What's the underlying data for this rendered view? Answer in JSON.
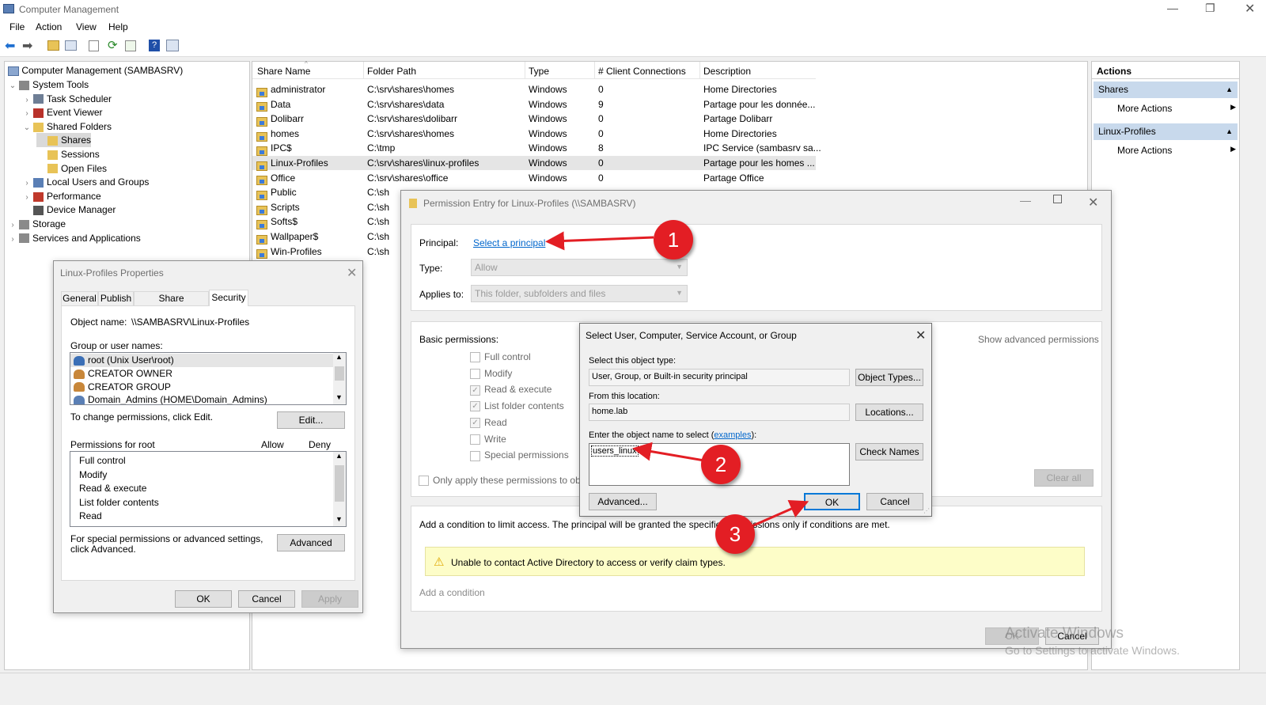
{
  "window": {
    "title": "Computer Management"
  },
  "menu": [
    "File",
    "Action",
    "View",
    "Help"
  ],
  "tree": {
    "root": "Computer Management (SAMBASRV)",
    "items": [
      {
        "label": "System Tools",
        "depth": 1,
        "exp": "v"
      },
      {
        "label": "Task Scheduler",
        "depth": 2,
        "exp": ">"
      },
      {
        "label": "Event Viewer",
        "depth": 2,
        "exp": ">"
      },
      {
        "label": "Shared Folders",
        "depth": 2,
        "exp": "v"
      },
      {
        "label": "Shares",
        "depth": 3,
        "exp": ""
      },
      {
        "label": "Sessions",
        "depth": 3,
        "exp": ""
      },
      {
        "label": "Open Files",
        "depth": 3,
        "exp": ""
      },
      {
        "label": "Local Users and Groups",
        "depth": 2,
        "exp": ">"
      },
      {
        "label": "Performance",
        "depth": 2,
        "exp": ">"
      },
      {
        "label": "Device Manager",
        "depth": 2,
        "exp": ""
      },
      {
        "label": "Storage",
        "depth": 1,
        "exp": ">"
      },
      {
        "label": "Services and Applications",
        "depth": 1,
        "exp": ">"
      }
    ]
  },
  "shares": {
    "columns": [
      "Share Name",
      "Folder Path",
      "Type",
      "# Client Connections",
      "Description"
    ],
    "rows": [
      [
        "administrator",
        "C:\\srv\\shares\\homes",
        "Windows",
        "0",
        "Home Directories"
      ],
      [
        "Data",
        "C:\\srv\\shares\\data",
        "Windows",
        "9",
        "Partage pour les donnée..."
      ],
      [
        "Dolibarr",
        "C:\\srv\\shares\\dolibarr",
        "Windows",
        "0",
        "Partage Dolibarr"
      ],
      [
        "homes",
        "C:\\srv\\shares\\homes",
        "Windows",
        "0",
        "Home Directories"
      ],
      [
        "IPC$",
        "C:\\tmp",
        "Windows",
        "8",
        "IPC Service (sambasrv sa..."
      ],
      [
        "Linux-Profiles",
        "C:\\srv\\shares\\linux-profiles",
        "Windows",
        "0",
        "Partage pour les homes ..."
      ],
      [
        "Office",
        "C:\\srv\\shares\\office",
        "Windows",
        "0",
        "Partage Office"
      ],
      [
        "Public",
        "C:\\sh",
        "",
        "",
        ""
      ],
      [
        "Scripts",
        "C:\\sh",
        "",
        "",
        ""
      ],
      [
        "Softs$",
        "C:\\sh",
        "",
        "",
        ""
      ],
      [
        "Wallpaper$",
        "C:\\sh",
        "",
        "",
        ""
      ],
      [
        "Win-Profiles",
        "C:\\sh",
        "",
        "",
        ""
      ]
    ]
  },
  "actions": {
    "header": "Actions",
    "sections": [
      {
        "title": "Shares",
        "item": "More Actions"
      },
      {
        "title": "Linux-Profiles",
        "item": "More Actions"
      }
    ]
  },
  "props": {
    "title": "Linux-Profiles Properties",
    "tabs": [
      "General",
      "Publish",
      "Share Permissions",
      "Security"
    ],
    "object_label": "Object name:",
    "object_value": "\\\\SAMBASRV\\Linux-Profiles",
    "group_label": "Group or user names:",
    "groups": [
      "root (Unix User\\root)",
      "CREATOR OWNER",
      "CREATOR GROUP",
      "Domain_Admins (HOME\\Domain_Admins)"
    ],
    "change_text": "To change permissions, click Edit.",
    "edit": "Edit...",
    "perm_for": "Permissions for root",
    "allow": "Allow",
    "deny": "Deny",
    "perms": [
      "Full control",
      "Modify",
      "Read & execute",
      "List folder contents",
      "Read"
    ],
    "special_text": "For special permissions or advanced settings, click Advanced.",
    "advanced": "Advanced",
    "ok": "OK",
    "cancel": "Cancel",
    "apply": "Apply"
  },
  "perm_entry": {
    "title": "Permission Entry for Linux-Profiles (\\\\SAMBASRV)",
    "principal_label": "Principal:",
    "principal_link": "Select a principal",
    "type_label": "Type:",
    "type_value": "Allow",
    "applies_label": "Applies to:",
    "applies_value": "This folder, subfolders and files",
    "basic_label": "Basic permissions:",
    "show_adv": "Show advanced permissions",
    "perms": [
      {
        "label": "Full control",
        "checked": false
      },
      {
        "label": "Modify",
        "checked": false
      },
      {
        "label": "Read & execute",
        "checked": true
      },
      {
        "label": "List folder contents",
        "checked": true
      },
      {
        "label": "Read",
        "checked": true
      },
      {
        "label": "Write",
        "checked": false
      },
      {
        "label": "Special permissions",
        "checked": false
      }
    ],
    "only_apply": "Only apply these permissions to obje",
    "clear_all": "Clear all",
    "condition_text": "Add a condition to limit access. The principal will be granted the specified permissions only if conditions are met.",
    "warning": "Unable to contact Active Directory to access or verify claim types.",
    "add_condition": "Add a condition",
    "ok": "OK",
    "cancel": "Cancel"
  },
  "select_dialog": {
    "title": "Select User, Computer, Service Account, or Group",
    "obj_type_label": "Select this object type:",
    "obj_type_value": "User, Group, or Built-in security principal",
    "obj_types_btn": "Object Types...",
    "location_label": "From this location:",
    "location_value": "home.lab",
    "locations_btn": "Locations...",
    "enter_label": "Enter the object name to select (",
    "examples": "examples",
    "enter_label_end": "):",
    "name_value": "users_linux",
    "check_names": "Check Names",
    "advanced": "Advanced...",
    "ok": "OK",
    "cancel": "Cancel"
  },
  "watermark": {
    "line1": "Activate Windows",
    "line2": "Go to Settings to activate Windows."
  },
  "callouts": [
    "1",
    "2",
    "3"
  ]
}
